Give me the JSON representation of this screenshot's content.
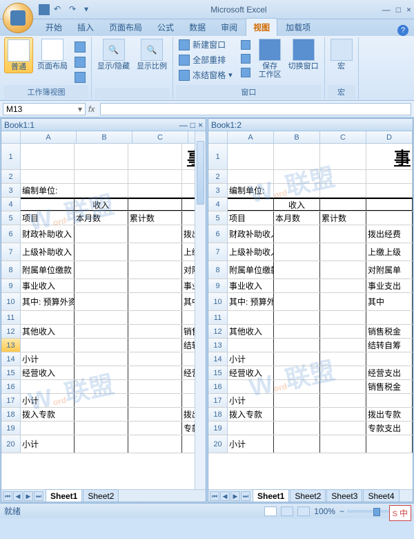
{
  "title": "Microsoft Excel",
  "tabs": [
    "开始",
    "插入",
    "页面布局",
    "公式",
    "数据",
    "审阅",
    "视图",
    "加载项"
  ],
  "activeTab": 6,
  "ribbon": {
    "g1": {
      "label": "工作簿视图",
      "btn1": "普通",
      "btn2": "页面布局"
    },
    "g2": {
      "btn1": "显示/隐藏",
      "btn2": "显示比例"
    },
    "g3": {
      "label": "窗口",
      "i1": "新建窗口",
      "i2": "全部重排",
      "i3": "冻结窗格",
      "b1": "保存\n工作区",
      "b2": "切换窗口"
    },
    "g4": {
      "label": "宏",
      "b1": "宏"
    }
  },
  "namebox": "M13",
  "panes": [
    {
      "title": "Book1:1",
      "cols": [
        "A",
        "B",
        "C",
        "D"
      ],
      "sheets": [
        "Sheet1",
        "Sheet2"
      ],
      "activeSheet": 0
    },
    {
      "title": "Book1:2",
      "cols": [
        "A",
        "B",
        "C",
        "D"
      ],
      "sheets": [
        "Sheet1",
        "Sheet2",
        "Sheet3",
        "Sheet4"
      ],
      "activeSheet": 0
    }
  ],
  "rows": {
    "r1_big": "事",
    "r3": "编制单位:",
    "r4": "收入",
    "r5_a": "项目",
    "r5_b": "本月数",
    "r5_c": "累计数",
    "r6_a": "财政补助收入",
    "r6_d_l": "拨出经",
    "r6_d_r": "拨出经费",
    "r7_a": "上级补助收入",
    "r7_d_l": "上缴",
    "r7_d_r": "上缴上级",
    "r8_a": "附属单位缴款",
    "r8_d_l": "对附",
    "r8_d_r": "对附属单",
    "r9_a": "事业收入",
    "r9_d_l": "事业",
    "r9_d_r": "事业支出",
    "r10_a": "其中: 预算外资金收入",
    "r10_d_l": "其中",
    "r10_d_r": "其中",
    "r12_a": "其他收入",
    "r12_d_l": "销售科",
    "r12_d_r": "销售税金",
    "r13_d_l": "结转",
    "r13_d_r": "结转自筹",
    "r14_a": "小计",
    "r15_a": "经营收入",
    "r15_d_l": "经营",
    "r15_d_r": "经营支出",
    "r16_d_r": "销售税金",
    "r17_a": "小计",
    "r18_a": "拨入专款",
    "r18_d_l": "拨出",
    "r18_d_r": "拨出专款",
    "r19_d_l": "专款",
    "r19_d_r": "专款支出",
    "r20_a": "小计"
  },
  "status": {
    "ready": "就绪",
    "zoom": "100%"
  },
  "ime": "中"
}
